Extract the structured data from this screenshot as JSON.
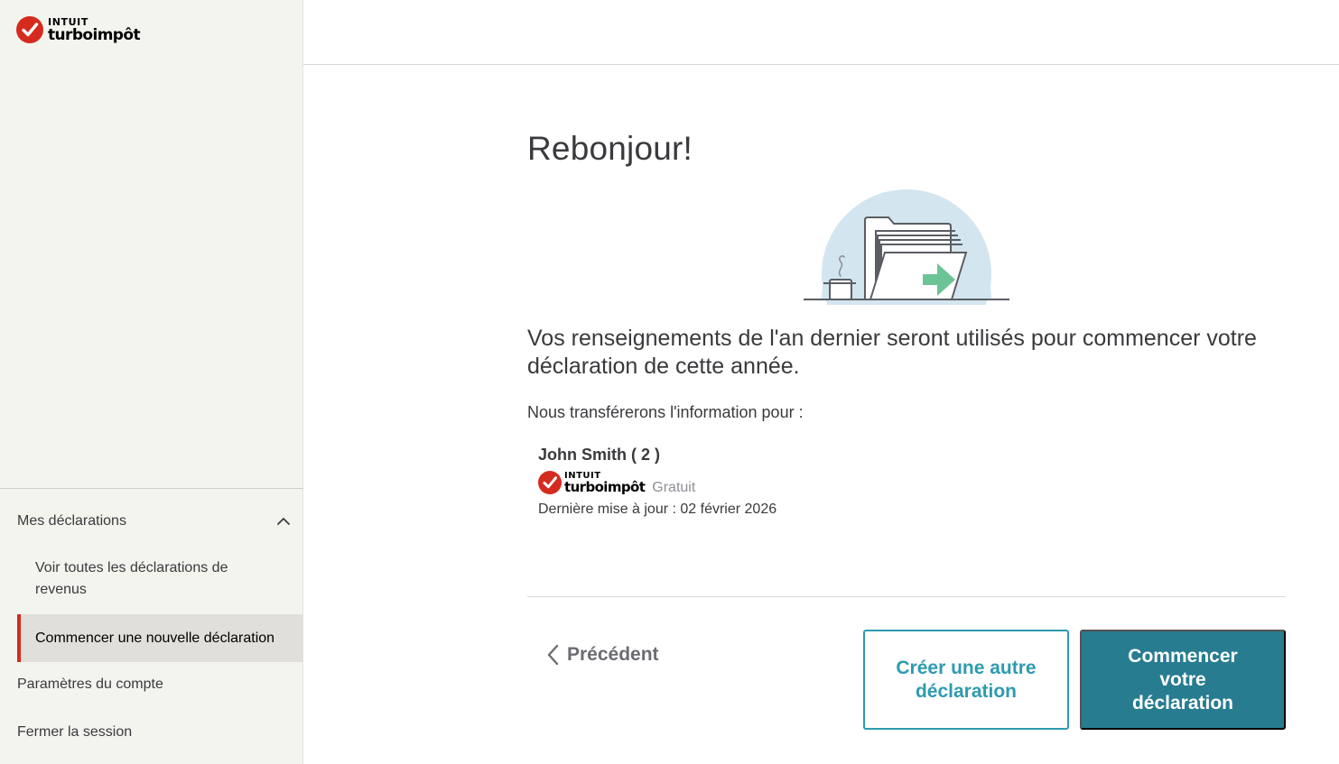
{
  "brand": {
    "top": "INTUIT",
    "bottom": "turboimpôt",
    "check_color": "#d52b1e"
  },
  "sidebar": {
    "section_label": "Mes déclarations",
    "sub_items": [
      "Voir toutes les déclarations de revenus",
      "Commencer une nouvelle déclaration"
    ],
    "active_index": 1,
    "items": [
      "Paramètres du compte",
      "Fermer la session"
    ]
  },
  "main": {
    "title": "Rebonjour!",
    "lead": "Vos renseignements de l'an dernier seront utilisés pour commencer votre déclaration de cette année.",
    "transfer_label": "Nous transférerons l'information pour :",
    "return": {
      "person": "John Smith ( 2 )",
      "product_top": "INTUIT",
      "product_bottom": "turboimpôt",
      "plan": "Gratuit",
      "updated": "Dernière mise à jour : 02 février 2026"
    },
    "back_label": "Précédent",
    "secondary_label": "Créer une autre déclaration",
    "primary_label": "Commencer votre déclaration"
  },
  "colors": {
    "accent": "#2d9bb0",
    "primary": "#277c90",
    "active_marker": "#d52b1e",
    "arrow_green": "#6cc396"
  }
}
